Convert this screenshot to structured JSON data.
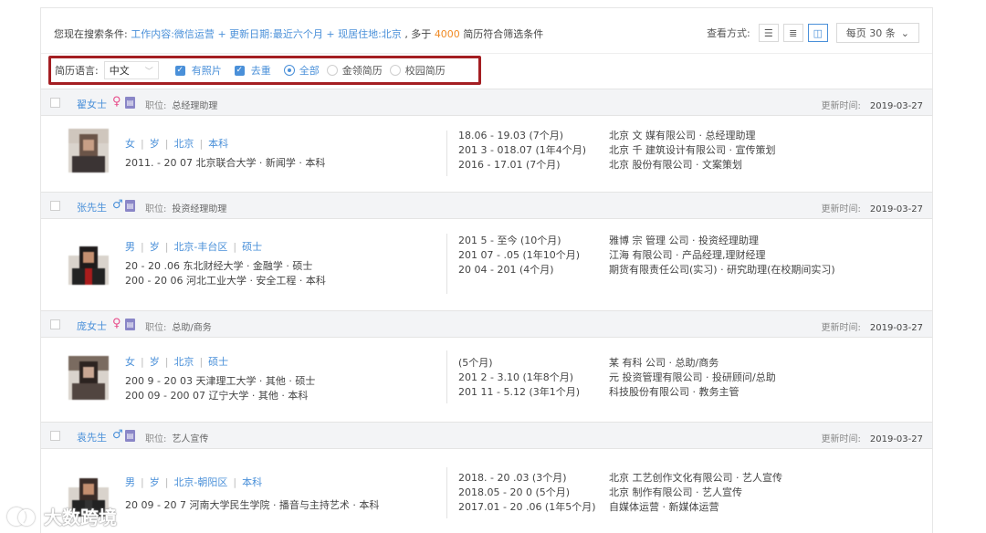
{
  "search": {
    "prefix": "您现在搜索条件:",
    "cond1": "工作内容:微信运营",
    "plus": "+",
    "cond2": "更新日期:最近六个月",
    "cond3": "现居住地:北京",
    "mid": ",  多于",
    "count": "4000",
    "suffix": "简历符合筛选条件"
  },
  "view": {
    "label": "查看方式:",
    "icons": [
      "list-icon",
      "detail-list-icon",
      "card-view-icon"
    ],
    "per_page": "每页 30 条",
    "chevron": "⌄"
  },
  "filters": {
    "lang_label": "简历语言:",
    "lang_value": "中文",
    "has_photo": "有照片",
    "dedupe": "去重",
    "radio_all": "全部",
    "radio_gold": "金领简历",
    "radio_campus": "校园简历"
  },
  "common": {
    "position_label": "职位:",
    "update_label": "更新时间:"
  },
  "colors": {
    "accent": "#4a90d9",
    "count": "#f08a24",
    "highlight_border": "#a41e22"
  },
  "candidates": [
    {
      "name": "翟女士",
      "gender": "♀",
      "position": "总经理助理",
      "updated": "2019-03-27",
      "basic": [
        "女",
        "岁",
        "北京",
        "本科"
      ],
      "edu": [
        "2011.  - 20  07 北京联合大学 · 新闻学 · 本科"
      ],
      "dates": [
        "18.06 - 19.03 (7个月)",
        "201  3 - 018.07 (1年4个月)",
        "2016  - 17.01 (7个月)"
      ],
      "desc": [
        "北京   文  媒有限公司 · 总经理助理",
        "北京   千  建筑设计有限公司 · 宣传策划",
        "北京  股份有限公司 · 文案策划"
      ]
    },
    {
      "name": "张先生",
      "gender": "♂",
      "position": "投资经理助理",
      "updated": "2019-03-27",
      "basic": [
        "男",
        "岁",
        "北京-丰台区",
        "硕士"
      ],
      "edu": [
        "20  - 20  .06 东北财经大学 · 金融学 · 硕士",
        "200   - 20  06 河北工业大学 · 安全工程 · 本科"
      ],
      "dates": [
        "201  5 - 至今 (10个月)",
        "201  07 - .05 (1年10个月)",
        "20  04 - 201   (4个月)"
      ],
      "desc": [
        "雅博  宗  管理  公司 · 投资经理助理",
        "江海  有限公司 · 产品经理,理财经理",
        "  期货有限责任公司(实习) · 研究助理(在校期间实习)"
      ]
    },
    {
      "name": "庞女士",
      "gender": "♀",
      "position": "总助/商务",
      "updated": "2019-03-27",
      "basic": [
        "女",
        "岁",
        "北京",
        "硕士"
      ],
      "edu": [
        "200  9 - 20  03 天津理工大学 · 其他 · 硕士",
        "200  09 - 200  07 辽宁大学 · 其他 · 本科"
      ],
      "dates": [
        "   (5个月)",
        "201  2 - 3.10 (1年8个月)",
        "201  11 - 5.12 (3年1个月)"
      ],
      "desc": [
        "某  有科  公司 · 总助/商务",
        "  元  投资管理有限公司 · 投研顾问/总助",
        "  科技股份有限公司 · 教务主管"
      ]
    },
    {
      "name": "袁先生",
      "gender": "♂",
      "position": "艺人宣传",
      "updated": "2019-03-27",
      "basic": [
        "男",
        "岁",
        "北京-朝阳区",
        "本科"
      ],
      "edu": [
        "20  09 - 20  7 河南大学民生学院 · 播音与主持艺术 · 本科"
      ],
      "dates": [
        "2018.  - 20  .03 (3个月)",
        "2018.05 - 20   0 (5个月)",
        "2017.01 - 20  .06 (1年5个月)"
      ],
      "desc": [
        "北京  工艺创作文化有限公司 · 艺人宣传",
        "北京  制作有限公司 · 艺人宣传",
        "自媒体运营 · 新媒体运营"
      ]
    }
  ],
  "watermark": {
    "text": "大数跨境"
  }
}
